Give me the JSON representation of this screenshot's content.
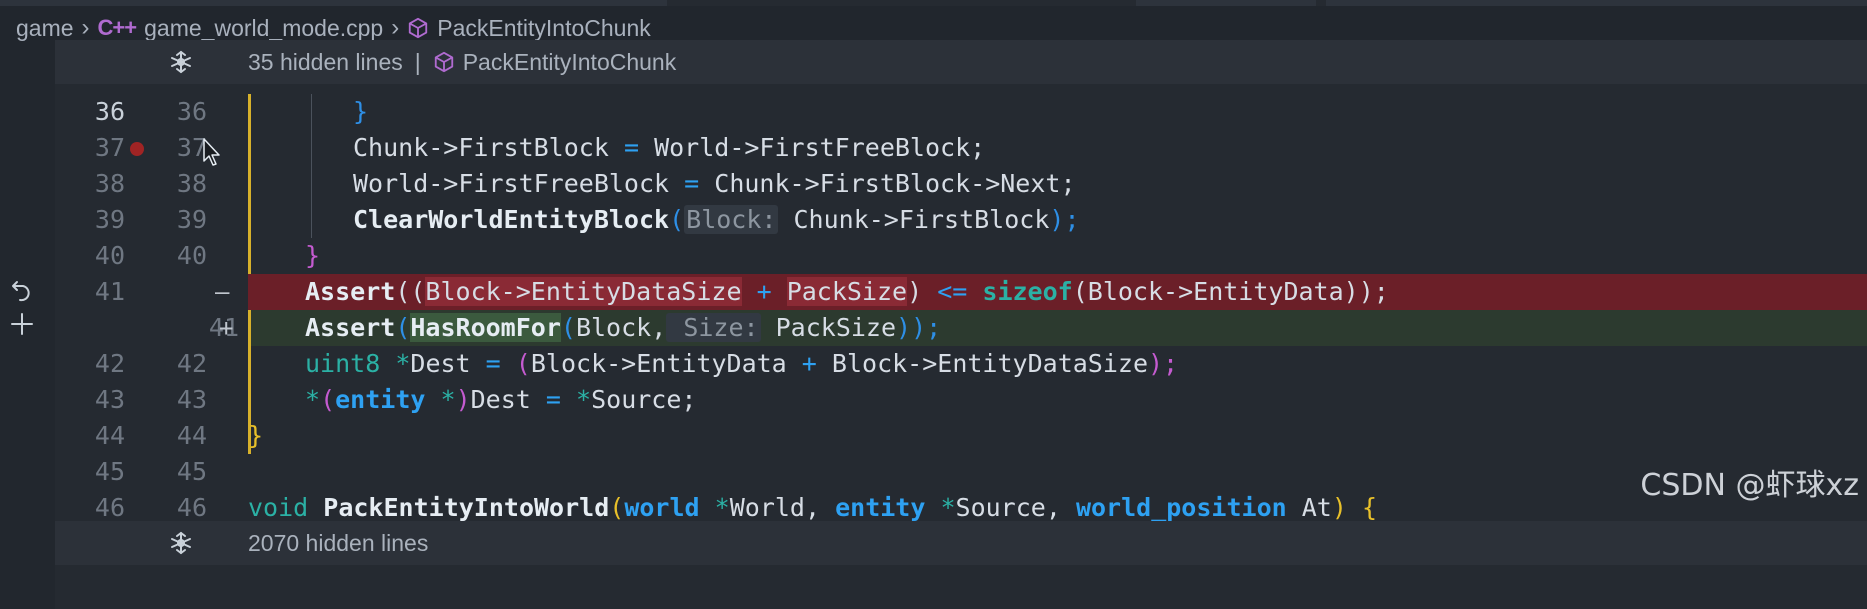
{
  "breadcrumb": {
    "root": "game",
    "file_badge": "C++",
    "file": "game_world_mode.cpp",
    "symbol": "PackEntityIntoChunk"
  },
  "fold_top": {
    "text": "35 hidden lines",
    "divider": "|",
    "symbol": "PackEntityIntoChunk"
  },
  "fold_bottom": {
    "text": "2070 hidden lines"
  },
  "lines": [
    {
      "old": "36",
      "new": "36"
    },
    {
      "old": "37",
      "new": "37"
    },
    {
      "old": "38",
      "new": "38"
    },
    {
      "old": "39",
      "new": "39"
    },
    {
      "old": "40",
      "new": "40"
    },
    {
      "old": "41",
      "new": "",
      "mark": "—"
    },
    {
      "old": "",
      "new": "41",
      "mark": "+"
    },
    {
      "old": "42",
      "new": "42"
    },
    {
      "old": "43",
      "new": "43"
    },
    {
      "old": "44",
      "new": "44"
    },
    {
      "old": "45",
      "new": "45"
    },
    {
      "old": "46",
      "new": "46"
    }
  ],
  "code": {
    "l36": {
      "brace": "}"
    },
    "l37": {
      "a": "Chunk->FirstBlock",
      "eq": "=",
      "b": "World->FirstFreeBlock;"
    },
    "l38": {
      "a": "World->FirstFreeBlock",
      "eq": "=",
      "b": "Chunk->FirstBlock->Next;"
    },
    "l39": {
      "fn": "ClearWorldEntityBlock",
      "open": "(",
      "hint": "Block:",
      "arg": " Chunk->FirstBlock",
      "close": ");"
    },
    "l40": {
      "brace": "}"
    },
    "l41r": {
      "fn": "Assert",
      "p1": "((",
      "a": "Block->EntityDataSize",
      "plus": "+",
      "b": "PackSize",
      "p2": ")",
      "le": "<=",
      "sizeof": "sizeof",
      "p3": "(",
      "c": "Block->EntityData",
      "p4": "));"
    },
    "l41a": {
      "fn": "Assert",
      "p1": "(",
      "fn2": "HasRoomFor",
      "p2": "(",
      "a": "Block,",
      "hint": " Size:",
      "b": " PackSize",
      "p3": "));"
    },
    "l42": {
      "type": "uint8",
      "star": "*",
      "name": "Dest",
      "eq": "=",
      "p1": "(",
      "a": "Block->EntityData",
      "plus": "+",
      "b": "Block->EntityDataSize",
      "p2": ");"
    },
    "l43": {
      "star": "*",
      "p1": "(",
      "type": "entity",
      "star2": "*",
      "p2": ")",
      "a": "Dest",
      "eq": "=",
      "star3": "*",
      "b": "Source;"
    },
    "l44": {
      "brace": "}"
    },
    "l46": {
      "kw": "void",
      "fn": "PackEntityIntoWorld",
      "p1": "(",
      "t1": "world",
      "s1": "*",
      "a1": "World,",
      "t2": "entity",
      "s2": "*",
      "a2": "Source,",
      "t3": "world_position",
      "a3": "At",
      "p2": ")",
      "brace": "{"
    }
  },
  "watermark": "CSDN @虾球xz",
  "icons": {
    "fold": "fold-expand-icon",
    "cube": "symbol-method-icon",
    "revert": "revert-icon",
    "add": "add-icon",
    "cursor": "mouse-pointer-icon"
  },
  "colors": {
    "background": "#252a31",
    "removed_line": "#6b1f28",
    "added_line": "#2c3a2f",
    "modified_bar": "#d7b12b",
    "breakpoint": "#a02424",
    "type_blue": "#2ea1f2",
    "teal": "#2bb1a5"
  }
}
